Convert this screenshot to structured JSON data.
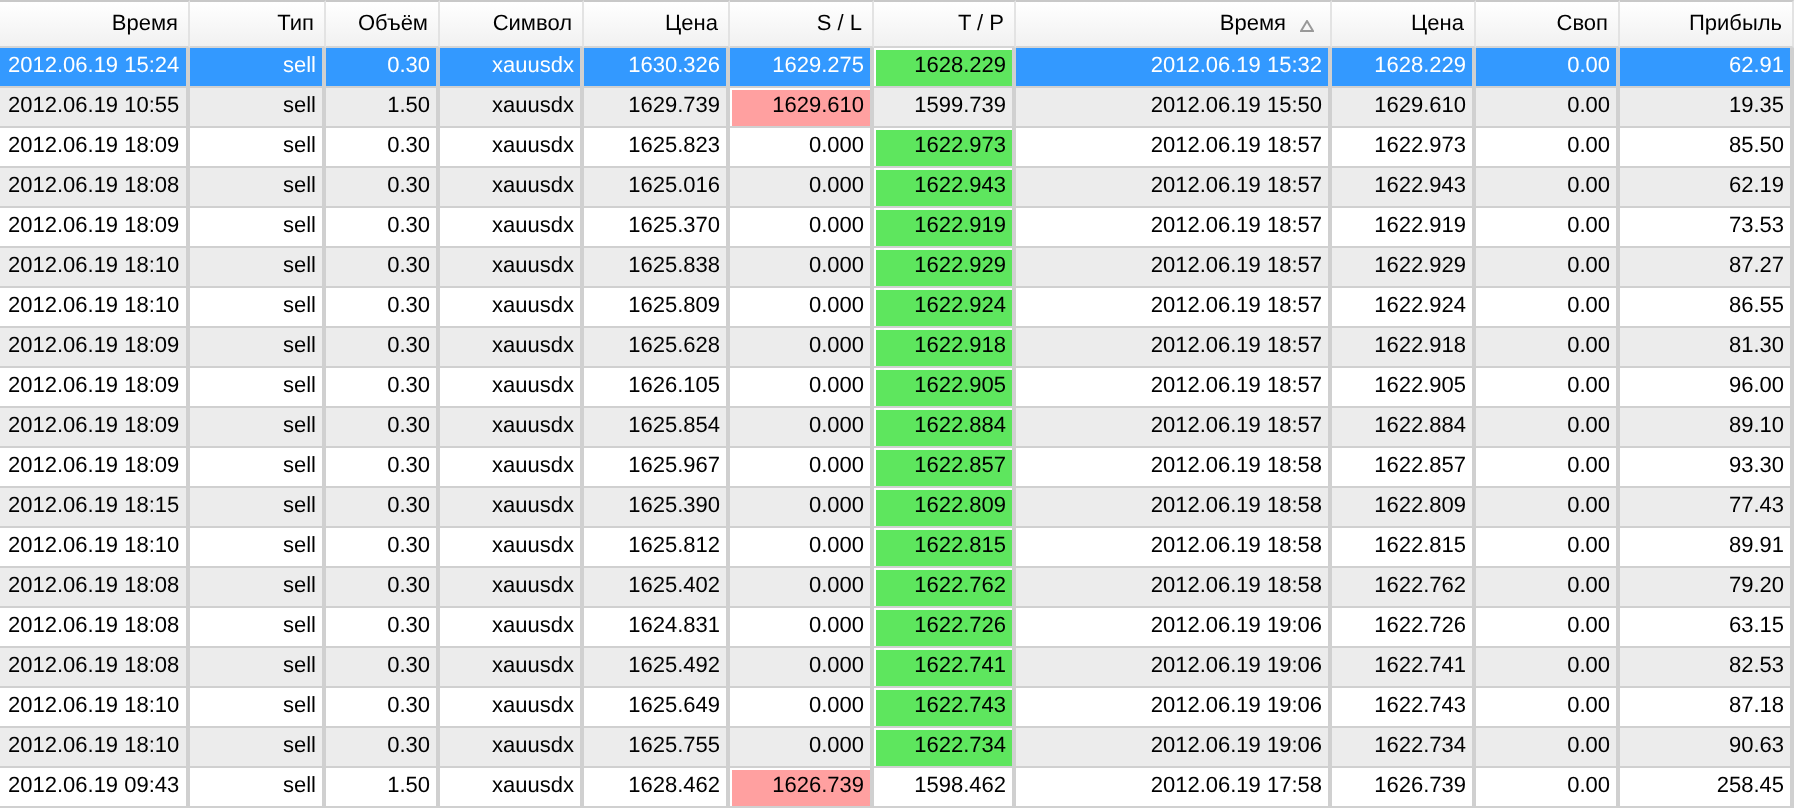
{
  "table": {
    "columns": [
      {
        "label": "Время",
        "sorted": false
      },
      {
        "label": "Тип",
        "sorted": false
      },
      {
        "label": "Объём",
        "sorted": false
      },
      {
        "label": "Символ",
        "sorted": false
      },
      {
        "label": "Цена",
        "sorted": false
      },
      {
        "label": "S / L",
        "sorted": false
      },
      {
        "label": "T / P",
        "sorted": false
      },
      {
        "label": "Время",
        "sorted": true
      },
      {
        "label": "Цена",
        "sorted": false
      },
      {
        "label": "Своп",
        "sorted": false
      },
      {
        "label": "Прибыль",
        "sorted": false
      }
    ],
    "rows": [
      {
        "time": "2012.06.19 15:24",
        "type": "sell",
        "volume": "0.30",
        "symbol": "xauusdx",
        "price": "1630.326",
        "sl": "1629.275",
        "tp": "1628.229",
        "close_time": "2012.06.19 15:32",
        "close_price": "1628.229",
        "swap": "0.00",
        "profit": "62.91",
        "selected": true,
        "sl_hit": false,
        "tp_hit": true
      },
      {
        "time": "2012.06.19 10:55",
        "type": "sell",
        "volume": "1.50",
        "symbol": "xauusdx",
        "price": "1629.739",
        "sl": "1629.610",
        "tp": "1599.739",
        "close_time": "2012.06.19 15:50",
        "close_price": "1629.610",
        "swap": "0.00",
        "profit": "19.35",
        "selected": false,
        "sl_hit": true,
        "tp_hit": false
      },
      {
        "time": "2012.06.19 18:09",
        "type": "sell",
        "volume": "0.30",
        "symbol": "xauusdx",
        "price": "1625.823",
        "sl": "0.000",
        "tp": "1622.973",
        "close_time": "2012.06.19 18:57",
        "close_price": "1622.973",
        "swap": "0.00",
        "profit": "85.50",
        "selected": false,
        "sl_hit": false,
        "tp_hit": true
      },
      {
        "time": "2012.06.19 18:08",
        "type": "sell",
        "volume": "0.30",
        "symbol": "xauusdx",
        "price": "1625.016",
        "sl": "0.000",
        "tp": "1622.943",
        "close_time": "2012.06.19 18:57",
        "close_price": "1622.943",
        "swap": "0.00",
        "profit": "62.19",
        "selected": false,
        "sl_hit": false,
        "tp_hit": true
      },
      {
        "time": "2012.06.19 18:09",
        "type": "sell",
        "volume": "0.30",
        "symbol": "xauusdx",
        "price": "1625.370",
        "sl": "0.000",
        "tp": "1622.919",
        "close_time": "2012.06.19 18:57",
        "close_price": "1622.919",
        "swap": "0.00",
        "profit": "73.53",
        "selected": false,
        "sl_hit": false,
        "tp_hit": true
      },
      {
        "time": "2012.06.19 18:10",
        "type": "sell",
        "volume": "0.30",
        "symbol": "xauusdx",
        "price": "1625.838",
        "sl": "0.000",
        "tp": "1622.929",
        "close_time": "2012.06.19 18:57",
        "close_price": "1622.929",
        "swap": "0.00",
        "profit": "87.27",
        "selected": false,
        "sl_hit": false,
        "tp_hit": true
      },
      {
        "time": "2012.06.19 18:10",
        "type": "sell",
        "volume": "0.30",
        "symbol": "xauusdx",
        "price": "1625.809",
        "sl": "0.000",
        "tp": "1622.924",
        "close_time": "2012.06.19 18:57",
        "close_price": "1622.924",
        "swap": "0.00",
        "profit": "86.55",
        "selected": false,
        "sl_hit": false,
        "tp_hit": true
      },
      {
        "time": "2012.06.19 18:09",
        "type": "sell",
        "volume": "0.30",
        "symbol": "xauusdx",
        "price": "1625.628",
        "sl": "0.000",
        "tp": "1622.918",
        "close_time": "2012.06.19 18:57",
        "close_price": "1622.918",
        "swap": "0.00",
        "profit": "81.30",
        "selected": false,
        "sl_hit": false,
        "tp_hit": true
      },
      {
        "time": "2012.06.19 18:09",
        "type": "sell",
        "volume": "0.30",
        "symbol": "xauusdx",
        "price": "1626.105",
        "sl": "0.000",
        "tp": "1622.905",
        "close_time": "2012.06.19 18:57",
        "close_price": "1622.905",
        "swap": "0.00",
        "profit": "96.00",
        "selected": false,
        "sl_hit": false,
        "tp_hit": true
      },
      {
        "time": "2012.06.19 18:09",
        "type": "sell",
        "volume": "0.30",
        "symbol": "xauusdx",
        "price": "1625.854",
        "sl": "0.000",
        "tp": "1622.884",
        "close_time": "2012.06.19 18:57",
        "close_price": "1622.884",
        "swap": "0.00",
        "profit": "89.10",
        "selected": false,
        "sl_hit": false,
        "tp_hit": true
      },
      {
        "time": "2012.06.19 18:09",
        "type": "sell",
        "volume": "0.30",
        "symbol": "xauusdx",
        "price": "1625.967",
        "sl": "0.000",
        "tp": "1622.857",
        "close_time": "2012.06.19 18:58",
        "close_price": "1622.857",
        "swap": "0.00",
        "profit": "93.30",
        "selected": false,
        "sl_hit": false,
        "tp_hit": true
      },
      {
        "time": "2012.06.19 18:15",
        "type": "sell",
        "volume": "0.30",
        "symbol": "xauusdx",
        "price": "1625.390",
        "sl": "0.000",
        "tp": "1622.809",
        "close_time": "2012.06.19 18:58",
        "close_price": "1622.809",
        "swap": "0.00",
        "profit": "77.43",
        "selected": false,
        "sl_hit": false,
        "tp_hit": true
      },
      {
        "time": "2012.06.19 18:10",
        "type": "sell",
        "volume": "0.30",
        "symbol": "xauusdx",
        "price": "1625.812",
        "sl": "0.000",
        "tp": "1622.815",
        "close_time": "2012.06.19 18:58",
        "close_price": "1622.815",
        "swap": "0.00",
        "profit": "89.91",
        "selected": false,
        "sl_hit": false,
        "tp_hit": true
      },
      {
        "time": "2012.06.19 18:08",
        "type": "sell",
        "volume": "0.30",
        "symbol": "xauusdx",
        "price": "1625.402",
        "sl": "0.000",
        "tp": "1622.762",
        "close_time": "2012.06.19 18:58",
        "close_price": "1622.762",
        "swap": "0.00",
        "profit": "79.20",
        "selected": false,
        "sl_hit": false,
        "tp_hit": true
      },
      {
        "time": "2012.06.19 18:08",
        "type": "sell",
        "volume": "0.30",
        "symbol": "xauusdx",
        "price": "1624.831",
        "sl": "0.000",
        "tp": "1622.726",
        "close_time": "2012.06.19 19:06",
        "close_price": "1622.726",
        "swap": "0.00",
        "profit": "63.15",
        "selected": false,
        "sl_hit": false,
        "tp_hit": true
      },
      {
        "time": "2012.06.19 18:08",
        "type": "sell",
        "volume": "0.30",
        "symbol": "xauusdx",
        "price": "1625.492",
        "sl": "0.000",
        "tp": "1622.741",
        "close_time": "2012.06.19 19:06",
        "close_price": "1622.741",
        "swap": "0.00",
        "profit": "82.53",
        "selected": false,
        "sl_hit": false,
        "tp_hit": true
      },
      {
        "time": "2012.06.19 18:10",
        "type": "sell",
        "volume": "0.30",
        "symbol": "xauusdx",
        "price": "1625.649",
        "sl": "0.000",
        "tp": "1622.743",
        "close_time": "2012.06.19 19:06",
        "close_price": "1622.743",
        "swap": "0.00",
        "profit": "87.18",
        "selected": false,
        "sl_hit": false,
        "tp_hit": true
      },
      {
        "time": "2012.06.19 18:10",
        "type": "sell",
        "volume": "0.30",
        "symbol": "xauusdx",
        "price": "1625.755",
        "sl": "0.000",
        "tp": "1622.734",
        "close_time": "2012.06.19 19:06",
        "close_price": "1622.734",
        "swap": "0.00",
        "profit": "90.63",
        "selected": false,
        "sl_hit": false,
        "tp_hit": true
      },
      {
        "time": "2012.06.19 09:43",
        "type": "sell",
        "volume": "1.50",
        "symbol": "xauusdx",
        "price": "1628.462",
        "sl": "1626.739",
        "tp": "1598.462",
        "close_time": "2012.06.19 17:58",
        "close_price": "1626.739",
        "swap": "0.00",
        "profit": "258.45",
        "selected": false,
        "sl_hit": true,
        "tp_hit": false
      }
    ]
  }
}
